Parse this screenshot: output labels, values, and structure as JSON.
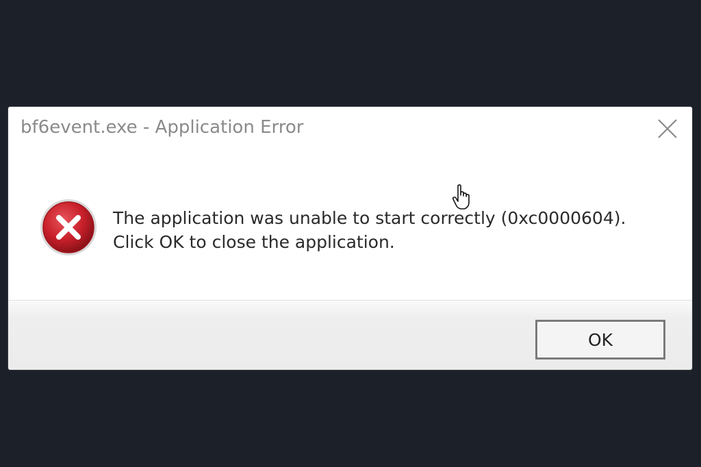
{
  "dialog": {
    "title": "bf6event.exe - Application Error",
    "close_icon": "close-icon",
    "error_icon": "error-x-icon",
    "message_line1": "The application was unable to start correctly (0xc0000604).",
    "message_line2": "Click OK to close the application.",
    "ok_label": "OK"
  },
  "colors": {
    "backdrop": "#1c2029",
    "dialog_background": "#ffffff",
    "footer_background": "#ececec",
    "error_red": "#c8202a",
    "title_text": "#8a8a8a"
  }
}
